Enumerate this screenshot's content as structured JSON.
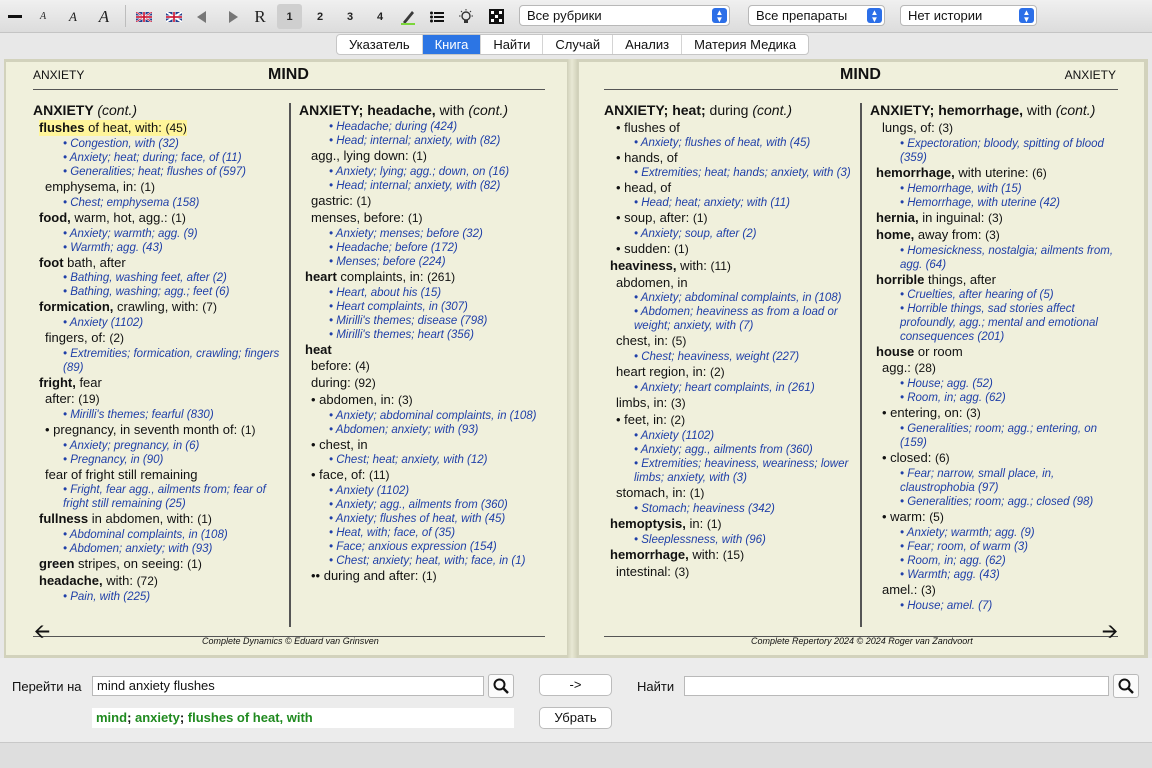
{
  "toolbar": {
    "icons": [
      "minus-icon",
      "font-small-icon",
      "font-medium-icon",
      "font-large-icon",
      "flag-uk-icon",
      "flag-uk-icon",
      "arrow-left-icon",
      "arrow-right-icon"
    ],
    "r_label": "R",
    "levels": [
      "1",
      "2",
      "3",
      "4"
    ],
    "dropdown_rubrics": "Все рубрики",
    "dropdown_remedies": "Все препараты",
    "dropdown_history": "Нет истории"
  },
  "tabs": [
    "Указатель",
    "Книга",
    "Найти",
    "Случай",
    "Анализ",
    "Материя Медика"
  ],
  "active_tab": "Книга",
  "left_page": {
    "running_head": "ANXIETY",
    "chapter": "MIND",
    "footer": "Complete Dynamics © Eduard van Grinsven"
  },
  "right_page": {
    "running_head": "ANXIETY",
    "chapter": "MIND",
    "footer": "Complete Repertory 2024 © 2024 Roger van Zandvoort"
  },
  "columns": {
    "c1": {
      "head": "ANXIETY",
      "head_tail": "(cont.)",
      "entries": [
        {
          "text": "flushes",
          "text2": " of heat, with:",
          "count": "(45)",
          "highlight": true,
          "xr": [
            "• Congestion, with (32)",
            "• Anxiety; heat; during; face, of (11)",
            "• Generalities; heat; flushes of (597)"
          ]
        },
        {
          "text": "",
          "text2": "emphysema, in:",
          "count": "(1)",
          "xr": [
            "• Chest; emphysema (158)"
          ]
        },
        {
          "text": "food,",
          "text2": " warm, hot, agg.:",
          "count": "(1)",
          "xr": [
            "• Anxiety; warmth; agg. (9)",
            "• Warmth; agg. (43)"
          ]
        },
        {
          "text": "foot",
          "text2": " bath, after",
          "count": "",
          "xr": [
            "• Bathing, washing feet, after (2)",
            "• Bathing, washing; agg.; feet (6)"
          ]
        },
        {
          "text": "formication,",
          "text2": " crawling, with:",
          "count": "(7)",
          "xr": [
            "• Anxiety (1102)"
          ]
        },
        {
          "text": "",
          "text2": "fingers, of:",
          "count": "(2)",
          "xr": [
            "• Extremities; formication, crawling; fingers (89)"
          ]
        },
        {
          "text": "fright,",
          "text2": " fear",
          "count": "",
          "xr": []
        },
        {
          "text": "",
          "text2": "after:",
          "count": "(19)",
          "xr": [
            "• Mirilli's themes; fearful (830)"
          ]
        },
        {
          "text": "",
          "text2": "• pregnancy, in seventh month of:",
          "count": "(1)",
          "xr": [
            "• Anxiety; pregnancy, in (6)",
            "• Pregnancy, in (90)"
          ]
        },
        {
          "text": "",
          "text2": "fear of fright still remaining",
          "count": "",
          "xr": [
            "• Fright, fear agg., ailments from; fear of fright still remaining (25)"
          ]
        },
        {
          "text": "fullness",
          "text2": " in abdomen, with:",
          "count": "(1)",
          "xr": [
            "• Abdominal complaints, in (108)",
            "• Abdomen; anxiety; with (93)"
          ]
        },
        {
          "text": "green",
          "text2": " stripes, on seeing:",
          "count": "(1)",
          "xr": []
        },
        {
          "text": "headache,",
          "text2": " with:",
          "count": "(72)",
          "xr": [
            "• Pain, with (225)"
          ]
        }
      ]
    },
    "c2": {
      "head": "ANXIETY; headache,",
      "head_mid": " with ",
      "head_tail": "(cont.)",
      "entries": [
        {
          "text": "",
          "text2": "",
          "count": "",
          "xr": [
            "• Headache; during (424)",
            "• Head; internal; anxiety, with (82)"
          ]
        },
        {
          "text": "",
          "text2": "agg., lying down:",
          "count": "(1)",
          "xr": [
            "• Anxiety; lying; agg.; down, on (16)",
            "• Head; internal; anxiety, with (82)"
          ]
        },
        {
          "text": "",
          "text2": "gastric:",
          "count": "(1)",
          "xr": []
        },
        {
          "text": "",
          "text2": "menses, before:",
          "count": "(1)",
          "xr": [
            "• Anxiety; menses; before (32)",
            "• Headache; before (172)",
            "• Menses; before (224)"
          ]
        },
        {
          "text": "heart",
          "text2": " complaints, in:",
          "count": "(261)",
          "xr": [
            "• Heart, about his (15)",
            "• Heart complaints, in (307)",
            "• Mirilli's themes; disease (798)",
            "• Mirilli's themes; heart (356)"
          ]
        },
        {
          "text": "heat",
          "text2": "",
          "count": "",
          "xr": []
        },
        {
          "text": "",
          "text2": "before:",
          "count": "(4)",
          "xr": []
        },
        {
          "text": "",
          "text2": "during:",
          "count": "(92)",
          "xr": []
        },
        {
          "text": "",
          "text2": "• abdomen, in:",
          "count": "(3)",
          "xr": [
            "• Anxiety; abdominal complaints, in (108)",
            "• Abdomen; anxiety; with (93)"
          ]
        },
        {
          "text": "",
          "text2": "• chest, in",
          "count": "",
          "xr": [
            "• Chest; heat; anxiety, with (12)"
          ]
        },
        {
          "text": "",
          "text2": "• face, of:",
          "count": "(11)",
          "xr": [
            "• Anxiety (1102)",
            "• Anxiety; agg., ailments from (360)",
            "• Anxiety; flushes of heat, with (45)",
            "• Heat, with; face, of (35)",
            "• Face; anxious expression (154)",
            "• Chest; anxiety; heat, with; face, in (1)"
          ]
        },
        {
          "text": "",
          "text2": "•• during and after:",
          "count": "(1)",
          "xr": []
        }
      ]
    },
    "c3": {
      "head": "ANXIETY; heat;",
      "head_mid": " during ",
      "head_tail": "(cont.)",
      "entries": [
        {
          "text": "",
          "text2": "• flushes of",
          "count": "",
          "xr": [
            "• Anxiety; flushes of heat, with (45)"
          ]
        },
        {
          "text": "",
          "text2": "• hands, of",
          "count": "",
          "xr": [
            "• Extremities; heat; hands; anxiety, with (3)"
          ]
        },
        {
          "text": "",
          "text2": "• head, of",
          "count": "",
          "xr": [
            "• Head; heat; anxiety; with (11)"
          ]
        },
        {
          "text": "",
          "text2": "• soup, after:",
          "count": "(1)",
          "xr": [
            "• Anxiety; soup, after (2)"
          ]
        },
        {
          "text": "",
          "text2": "• sudden:",
          "count": "(1)",
          "xr": []
        },
        {
          "text": "heaviness,",
          "text2": " with:",
          "count": "(11)",
          "xr": []
        },
        {
          "text": "",
          "text2": "abdomen, in",
          "count": "",
          "xr": [
            "• Anxiety; abdominal complaints, in (108)",
            "• Abdomen; heaviness as from a load or weight; anxiety, with (7)"
          ]
        },
        {
          "text": "",
          "text2": "chest, in:",
          "count": "(5)",
          "xr": [
            "• Chest; heaviness, weight (227)"
          ]
        },
        {
          "text": "",
          "text2": "heart region, in:",
          "count": "(2)",
          "xr": [
            "• Anxiety; heart complaints, in (261)"
          ]
        },
        {
          "text": "",
          "text2": "limbs, in:",
          "count": "(3)",
          "xr": []
        },
        {
          "text": "",
          "text2": "• feet, in:",
          "count": "(2)",
          "xr": [
            "• Anxiety (1102)",
            "• Anxiety; agg., ailments from (360)",
            "• Extremities; heaviness, weariness; lower limbs; anxiety, with (3)"
          ]
        },
        {
          "text": "",
          "text2": "stomach, in:",
          "count": "(1)",
          "xr": [
            "• Stomach; heaviness (342)"
          ]
        },
        {
          "text": "hemoptysis,",
          "text2": " in:",
          "count": "(1)",
          "xr": [
            "• Sleeplessness, with (96)"
          ]
        },
        {
          "text": "hemorrhage,",
          "text2": " with:",
          "count": "(15)",
          "xr": []
        },
        {
          "text": "",
          "text2": "intestinal:",
          "count": "(3)",
          "xr": []
        }
      ]
    },
    "c4": {
      "head": "ANXIETY; hemorrhage,",
      "head_mid": " with ",
      "head_tail": "(cont.)",
      "entries": [
        {
          "text": "",
          "text2": "lungs, of:",
          "count": "(3)",
          "xr": [
            "• Expectoration; bloody, spitting of blood (359)"
          ]
        },
        {
          "text": "hemorrhage,",
          "text2": " with uterine:",
          "count": "(6)",
          "xr": [
            "• Hemorrhage, with (15)",
            "• Hemorrhage, with uterine (42)"
          ]
        },
        {
          "text": "hernia,",
          "text2": " in inguinal:",
          "count": "(3)",
          "xr": []
        },
        {
          "text": "home,",
          "text2": " away from:",
          "count": "(3)",
          "xr": [
            "• Homesickness, nostalgia; ailments from, agg. (64)"
          ]
        },
        {
          "text": "horrible",
          "text2": " things, after",
          "count": "",
          "xr": [
            "• Cruelties, after hearing of (5)",
            "• Horrible things, sad stories affect profoundly, agg.; mental and emotional consequences (201)"
          ]
        },
        {
          "text": "house",
          "text2": " or room",
          "count": "",
          "xr": []
        },
        {
          "text": "",
          "text2": "agg.:",
          "count": "(28)",
          "xr": [
            "• House; agg. (52)",
            "• Room, in; agg. (62)"
          ]
        },
        {
          "text": "",
          "text2": "• entering, on:",
          "count": "(3)",
          "xr": [
            "• Generalities; room; agg.; entering, on (159)"
          ]
        },
        {
          "text": "",
          "text2": "• closed:",
          "count": "(6)",
          "xr": [
            "• Fear; narrow, small place, in, claustrophobia (97)",
            "• Generalities; room; agg.; closed (98)"
          ]
        },
        {
          "text": "",
          "text2": "• warm:",
          "count": "(5)",
          "xr": [
            "• Anxiety; warmth; agg. (9)",
            "• Fear; room, of warm (3)",
            "• Room, in; agg. (62)",
            "• Warmth; agg. (43)"
          ]
        },
        {
          "text": "",
          "text2": "amel.:",
          "count": "(3)",
          "xr": [
            "• House; amel. (7)"
          ]
        }
      ]
    }
  },
  "bottom": {
    "goto_label": "Перейти на",
    "goto_value": "mind anxiety flushes",
    "arrow_button": "->",
    "find_label": "Найти",
    "find_value": "",
    "clear_button": "Убрать",
    "crumb": [
      "mind",
      "anxiety",
      "flushes of heat, with"
    ]
  }
}
